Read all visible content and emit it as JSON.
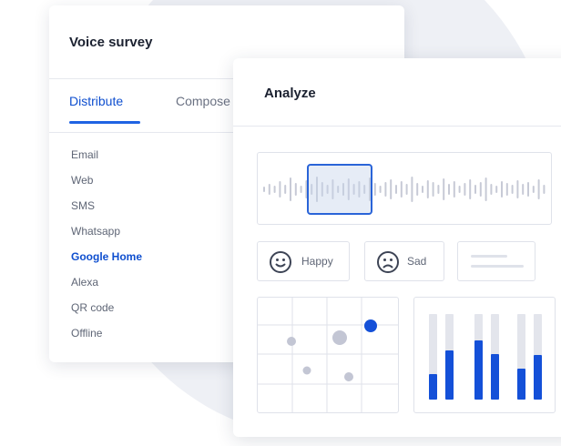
{
  "survey": {
    "title": "Voice survey",
    "tabs": [
      {
        "label": "Distribute",
        "active": true
      },
      {
        "label": "Compose",
        "active": false
      }
    ],
    "channels": [
      {
        "label": "Email",
        "active": false
      },
      {
        "label": "Web",
        "active": false
      },
      {
        "label": "SMS",
        "active": false
      },
      {
        "label": "Whatsapp",
        "active": false
      },
      {
        "label": "Google Home",
        "active": true
      },
      {
        "label": "Alexa",
        "active": false
      },
      {
        "label": "QR code",
        "active": false
      },
      {
        "label": "Offline",
        "active": false
      }
    ]
  },
  "analyze": {
    "title": "Analyze",
    "sentiments": [
      {
        "label": "Happy",
        "icon": "smiley-face-icon"
      },
      {
        "label": "Sad",
        "icon": "sad-face-icon"
      }
    ],
    "text_placeholder_icon": "text-lines-icon",
    "waveform_icon": "audio-waveform-icon"
  },
  "colors": {
    "accent": "#1f63e3",
    "accent_text": "#0f4fcf",
    "muted_dot": "#c3c6d4",
    "bar_track": "#e3e5ec",
    "bar_fill": "#1450d8",
    "background_circle": "#eef0f5"
  }
}
